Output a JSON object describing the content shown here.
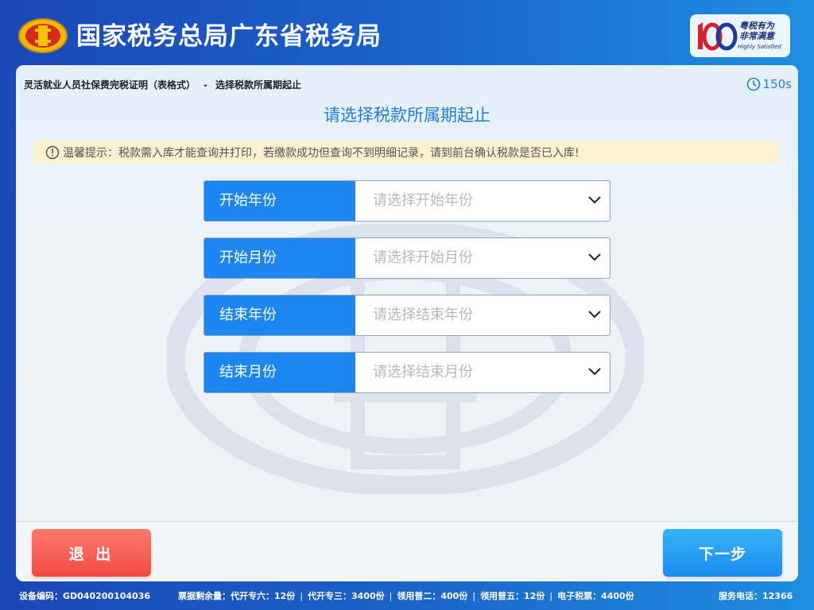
{
  "header": {
    "title": "国家税务总局广东省税务局",
    "brand": {
      "slogan_line1": "粤税有为",
      "slogan_line2": "非常满意",
      "slogan_en": "Highly Satisfied",
      "number": "100"
    }
  },
  "breadcrumb": {
    "service": "灵活就业人员社保费完税证明（表格式）",
    "separator": "-",
    "step": "选择税款所属期起止"
  },
  "timer": "150s",
  "page_title": "请选择税款所属期起止",
  "notice": "温馨提示：税款需入库才能查询并打印，若缴款成功但查询不到明细记录，请到前台确认税款是否已入库!",
  "fields": [
    {
      "label": "开始年份",
      "placeholder": "请选择开始年份"
    },
    {
      "label": "开始月份",
      "placeholder": "请选择开始月份"
    },
    {
      "label": "结束年份",
      "placeholder": "请选择结束年份"
    },
    {
      "label": "结束月份",
      "placeholder": "请选择结束月份"
    }
  ],
  "buttons": {
    "exit": "退 出",
    "next": "下一步"
  },
  "status": {
    "device": "设备编码：GD040200104036",
    "ticket_label": "票据剩余量：",
    "ticket_items": [
      "代开专六：12份",
      "代开专三：3400份",
      "领用普二：400份",
      "领用普五：12份",
      "电子税票：4400份"
    ],
    "hotline": "服务电话：12366"
  },
  "colors": {
    "primary": "#1e86f0",
    "exit": "#f24a42",
    "notice_bg": "#fbf0cf"
  }
}
